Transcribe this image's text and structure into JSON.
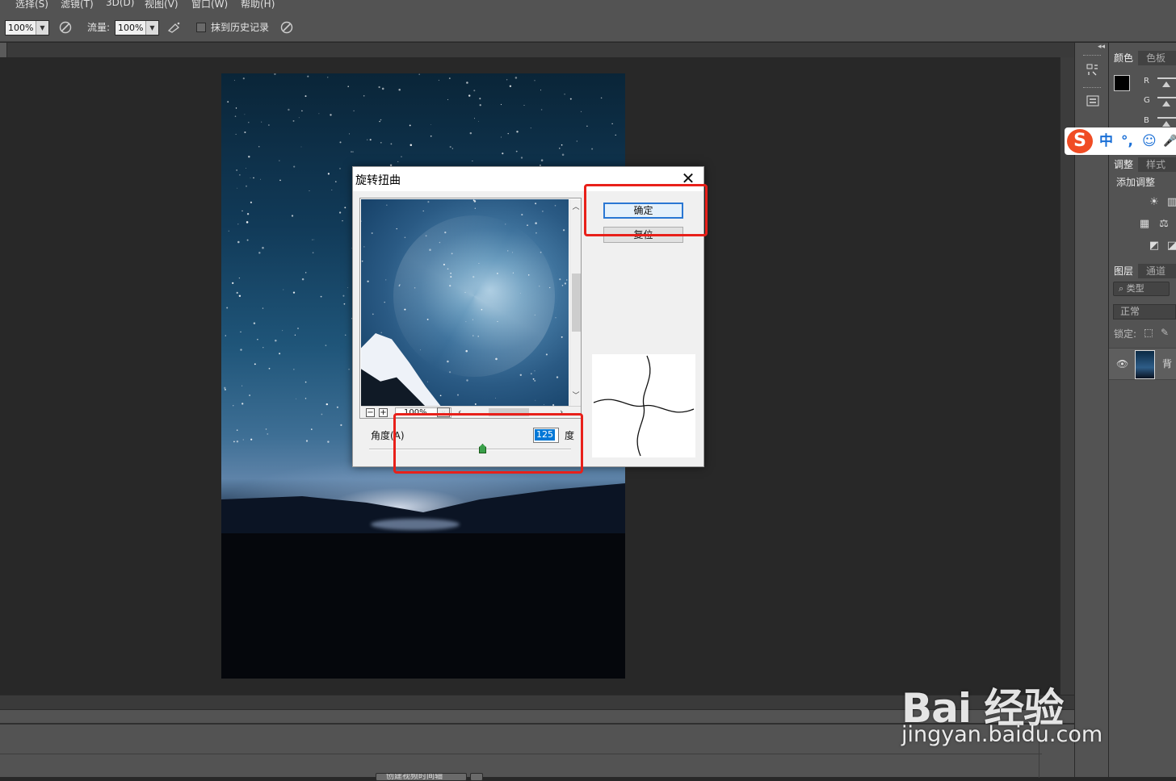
{
  "menubar": {
    "items": [
      "选择(S)",
      "滤镜(T)",
      "3D(D)",
      "视图(V)",
      "窗口(W)",
      "帮助(H)"
    ]
  },
  "options": {
    "opacity_value": "100%",
    "flow_label": "流量:",
    "flow_value": "100%",
    "history_label": "抹到历史记录"
  },
  "panels": {
    "color_tab": "颜色",
    "swatches_tab": "色板",
    "r": "R",
    "g": "G",
    "b": "B",
    "adjust_tab": "调整",
    "styles_tab": "样式",
    "add_adjust": "添加调整",
    "layers_tab": "图层",
    "channels_tab": "通道",
    "kind_filter": "类型",
    "blend_mode": "正常",
    "lock_label": "锁定:"
  },
  "ime": {
    "logo": "S",
    "mode": "中",
    "punct": "°,",
    "emoji": "☺",
    "mic": "🎤"
  },
  "dialog": {
    "title": "旋转扭曲",
    "ok_label": "确定",
    "reset_label": "复位",
    "zoom_value": "100%",
    "angle_label": "角度(A)",
    "angle_value": "125",
    "angle_unit": "度",
    "angle_min": -999,
    "angle_max": 999
  },
  "timeline": {
    "create_button": "创建视频时间轴"
  },
  "watermark": {
    "brand": "Bai 经验",
    "url": "jingyan.baidu.com"
  },
  "colors": {
    "highlight_box": "#e8201a",
    "dialog_bg": "#f0f0f0",
    "app_bg": "#535353",
    "canvas_bg": "#282828"
  }
}
